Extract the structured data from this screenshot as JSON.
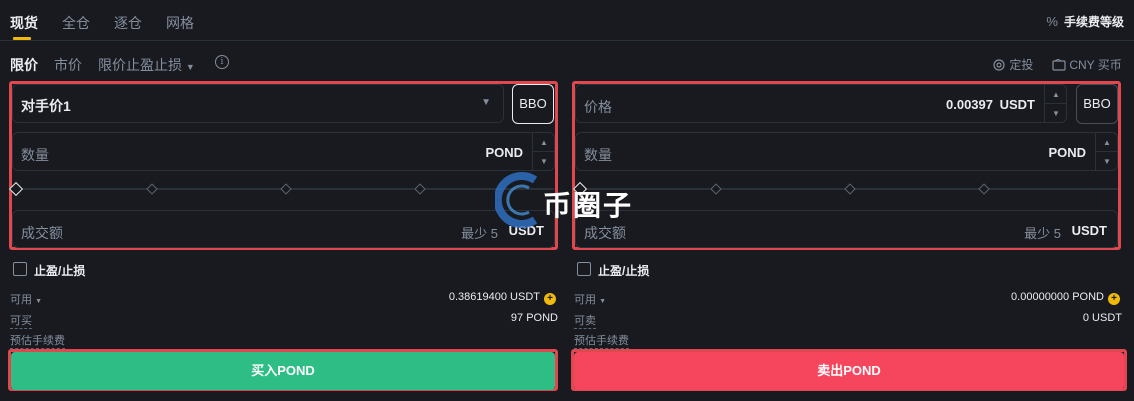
{
  "tabs": [
    "现货",
    "全仓",
    "逐仓",
    "网格"
  ],
  "fee_level": {
    "icon": "percent-icon",
    "label": "手续费等级"
  },
  "order_types": {
    "limit": "限价",
    "market": "市价",
    "stop_limit": "限价止盈止损"
  },
  "links": {
    "dca": "定投",
    "buy_cny": "CNY 买币"
  },
  "buy": {
    "price_select": "对手价1",
    "bbo": "BBO",
    "amount_label": "数量",
    "amount_unit": "POND",
    "total_label": "成交额",
    "total_min": "最少 5",
    "total_unit": "USDT",
    "tp_sl": "止盈/止损",
    "available_label": "可用",
    "available_value": "0.38619400 USDT",
    "max_label": "可买",
    "max_value": "97 POND",
    "fee_label": "预估手续费",
    "button": "买入POND"
  },
  "sell": {
    "price_label": "价格",
    "price_value": "0.00397",
    "price_unit": "USDT",
    "bbo": "BBO",
    "amount_label": "数量",
    "amount_unit": "POND",
    "total_label": "成交额",
    "total_min": "最少 5",
    "total_unit": "USDT",
    "tp_sl": "止盈/止损",
    "available_label": "可用",
    "available_value": "0.00000000 POND",
    "max_label": "可卖",
    "max_value": "0 USDT",
    "fee_label": "预估手续费",
    "button": "卖出POND"
  },
  "watermark": "币圈子",
  "colors": {
    "accent": "#f0b90b",
    "buy": "#2ebd85",
    "sell": "#f6465d",
    "highlight": "#e0474f"
  }
}
